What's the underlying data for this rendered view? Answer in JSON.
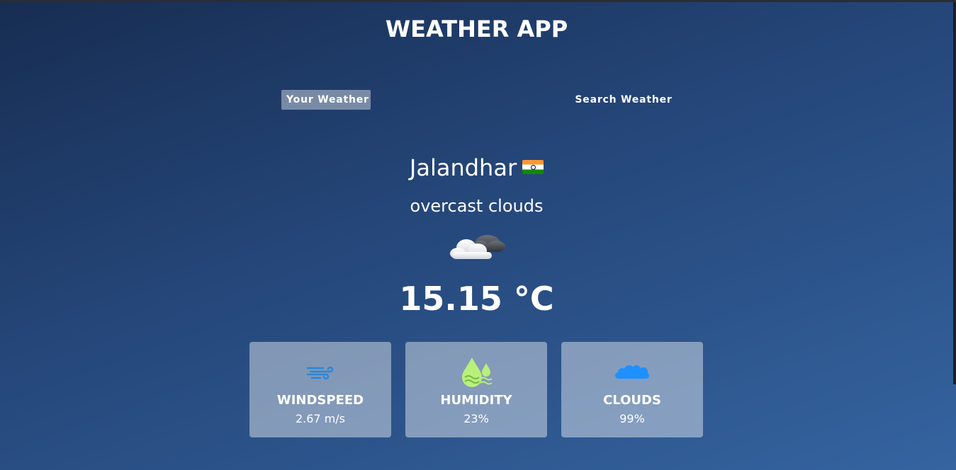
{
  "app": {
    "title": "WEATHER APP"
  },
  "tabs": [
    {
      "label": "Your Weather",
      "active": true
    },
    {
      "label": "Search Weather",
      "active": false
    }
  ],
  "location": {
    "city": "Jalandhar",
    "flag_icon": "india-flag-icon"
  },
  "current": {
    "condition": "overcast clouds",
    "icon": "cloud-icon",
    "temperature": "15.15 °C"
  },
  "stats": [
    {
      "icon": "wind-icon",
      "label": "WINDSPEED",
      "value": "2.67 m/s",
      "color": "#2b86d6"
    },
    {
      "icon": "humidity-drop-icon",
      "label": "HUMIDITY",
      "value": "23%",
      "color": "#b7f07a"
    },
    {
      "icon": "cloud-stat-icon",
      "label": "CLOUDS",
      "value": "99%",
      "color": "#1e90ff"
    }
  ]
}
